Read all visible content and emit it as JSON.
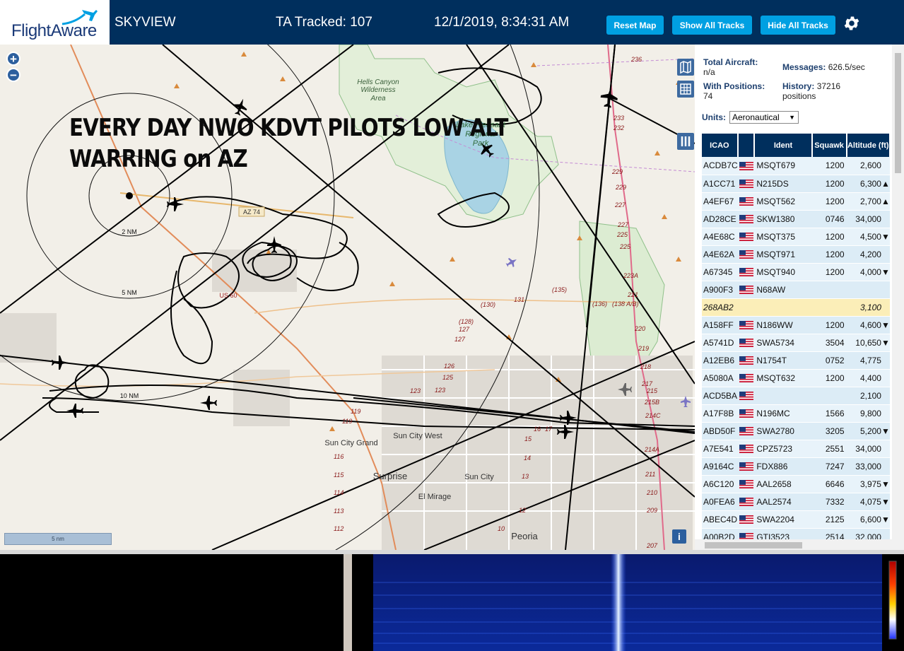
{
  "header": {
    "logo_text": "FlightAware",
    "app_title": "SKYVIEW",
    "tracked": "TA Tracked: 107",
    "datetime": "12/1/2019, 8:34:31 AM",
    "buttons": {
      "reset": "Reset Map",
      "show_all": "Show All Tracks",
      "hide_all": "Hide All Tracks"
    }
  },
  "map": {
    "overlay_line1": "EVERY DAY NWO KDVT PILOTS LOW ALT",
    "overlay_line2": "WARRING on AZ",
    "zoom_in": "+",
    "zoom_out": "−",
    "scale_label": "5 nm",
    "info": "i",
    "ring_labels": [
      "2 NM",
      "5 NM",
      "10 NM"
    ],
    "places": {
      "hells_canyon": "Hells Canyon\nWilderness\nArea",
      "lake_pleasant": "Lake Pleasant\nRegional\nPark",
      "sun_city_grand": "Sun City Grand",
      "sun_city_west": "Sun City West",
      "surprise": "Surprise",
      "sun_city": "Sun City",
      "el_mirage": "El Mirage",
      "peoria": "Peoria"
    },
    "roads": {
      "az74": "AZ 74",
      "us60": "US 60",
      "r135": "(135)",
      "r130": "(130)",
      "r131": "131",
      "r128": "(128)",
      "r127a": "127",
      "r127b": "127",
      "r136": "(136)",
      "r138": "(138 A/B)",
      "r123": "123",
      "r123b": "123",
      "r125": "125",
      "r126": "126",
      "r119": "119",
      "r119b": "119",
      "r116": "116",
      "r115": "115",
      "r114": "114",
      "r113": "113",
      "r112": "112",
      "r17": "17",
      "r16": "16",
      "r15": "15",
      "r14": "14",
      "r13": "13",
      "r12": "12",
      "r10": "10",
      "mile": [
        "236",
        "233",
        "232",
        "229",
        "229",
        "227",
        "227",
        "225",
        "225",
        "223A",
        "221",
        "220",
        "219",
        "218",
        "217",
        "215B",
        "214C",
        "214A",
        "211",
        "210",
        "209",
        "207",
        "215"
      ]
    }
  },
  "sidebar": {
    "total_aircraft_label": "Total Aircraft:",
    "total_aircraft": "n/a",
    "messages_label": "Messages:",
    "messages": "626.5/sec",
    "with_positions_label": "With Positions:",
    "with_positions": "74",
    "history_label": "History:",
    "history": "37216",
    "history_unit": "positions",
    "units_label": "Units:",
    "units_value": "Aeronautical",
    "columns": [
      "ICAO",
      "",
      "Ident",
      "Squawk",
      "Altitude (ft)"
    ],
    "rows": [
      {
        "icao": "ACDB7C",
        "ident": "MSQT679",
        "squawk": "1200",
        "alt": "2,600",
        "vr": ""
      },
      {
        "icao": "A1CC71",
        "ident": "N215DS",
        "squawk": "1200",
        "alt": "6,300",
        "vr": "▲"
      },
      {
        "icao": "A4EF67",
        "ident": "MSQT562",
        "squawk": "1200",
        "alt": "2,700",
        "vr": "▲"
      },
      {
        "icao": "AD28CE",
        "ident": "SKW1380",
        "squawk": "0746",
        "alt": "34,000",
        "vr": ""
      },
      {
        "icao": "A4E68C",
        "ident": "MSQT375",
        "squawk": "1200",
        "alt": "4,500",
        "vr": "▼"
      },
      {
        "icao": "A4E62A",
        "ident": "MSQT971",
        "squawk": "1200",
        "alt": "4,200",
        "vr": ""
      },
      {
        "icao": "A67345",
        "ident": "MSQT940",
        "squawk": "1200",
        "alt": "4,000",
        "vr": "▼"
      },
      {
        "icao": "A900F3",
        "ident": "N68AW",
        "squawk": "",
        "alt": "",
        "vr": ""
      },
      {
        "icao": "268AB2",
        "ident": "",
        "squawk": "",
        "alt": "3,100",
        "vr": "",
        "highlight": true
      },
      {
        "icao": "A158FF",
        "ident": "N186WW",
        "squawk": "1200",
        "alt": "4,600",
        "vr": "▼"
      },
      {
        "icao": "A5741D",
        "ident": "SWA5734",
        "squawk": "3504",
        "alt": "10,650",
        "vr": "▼"
      },
      {
        "icao": "A12EB6",
        "ident": "N1754T",
        "squawk": "0752",
        "alt": "4,775",
        "vr": ""
      },
      {
        "icao": "A5080A",
        "ident": "MSQT632",
        "squawk": "1200",
        "alt": "4,400",
        "vr": ""
      },
      {
        "icao": "ACD5BA",
        "ident": "",
        "squawk": "",
        "alt": "2,100",
        "vr": ""
      },
      {
        "icao": "A17F8B",
        "ident": "N196MC",
        "squawk": "1566",
        "alt": "9,800",
        "vr": ""
      },
      {
        "icao": "ABD50F",
        "ident": "SWA2780",
        "squawk": "3205",
        "alt": "5,200",
        "vr": "▼"
      },
      {
        "icao": "A7E541",
        "ident": "CPZ5723",
        "squawk": "2551",
        "alt": "34,000",
        "vr": ""
      },
      {
        "icao": "A9164C",
        "ident": "FDX886",
        "squawk": "7247",
        "alt": "33,000",
        "vr": ""
      },
      {
        "icao": "A6C120",
        "ident": "AAL2658",
        "squawk": "6646",
        "alt": "3,975",
        "vr": "▼"
      },
      {
        "icao": "A0FEA6",
        "ident": "AAL2574",
        "squawk": "7332",
        "alt": "4,075",
        "vr": "▼"
      },
      {
        "icao": "ABEC4D",
        "ident": "SWA2204",
        "squawk": "2125",
        "alt": "6,600",
        "vr": "▼"
      },
      {
        "icao": "A00B2D",
        "ident": "GTI3523",
        "squawk": "2514",
        "alt": "32,000",
        "vr": ""
      }
    ]
  },
  "colors": {
    "header_bg": "#002f5d",
    "button_bg": "#00a0e2",
    "table_header_bg": "#002f5d",
    "row_even": "#dcecf6",
    "row_odd": "#e8f3fa",
    "highlight_row": "#fbeeb8"
  },
  "icons": {
    "gear": "gear-icon",
    "map_layers": "map-icon",
    "grid": "grid-icon",
    "columns": "columns-icon",
    "flag": "us-flag-icon",
    "plane": "airplane-icon"
  }
}
